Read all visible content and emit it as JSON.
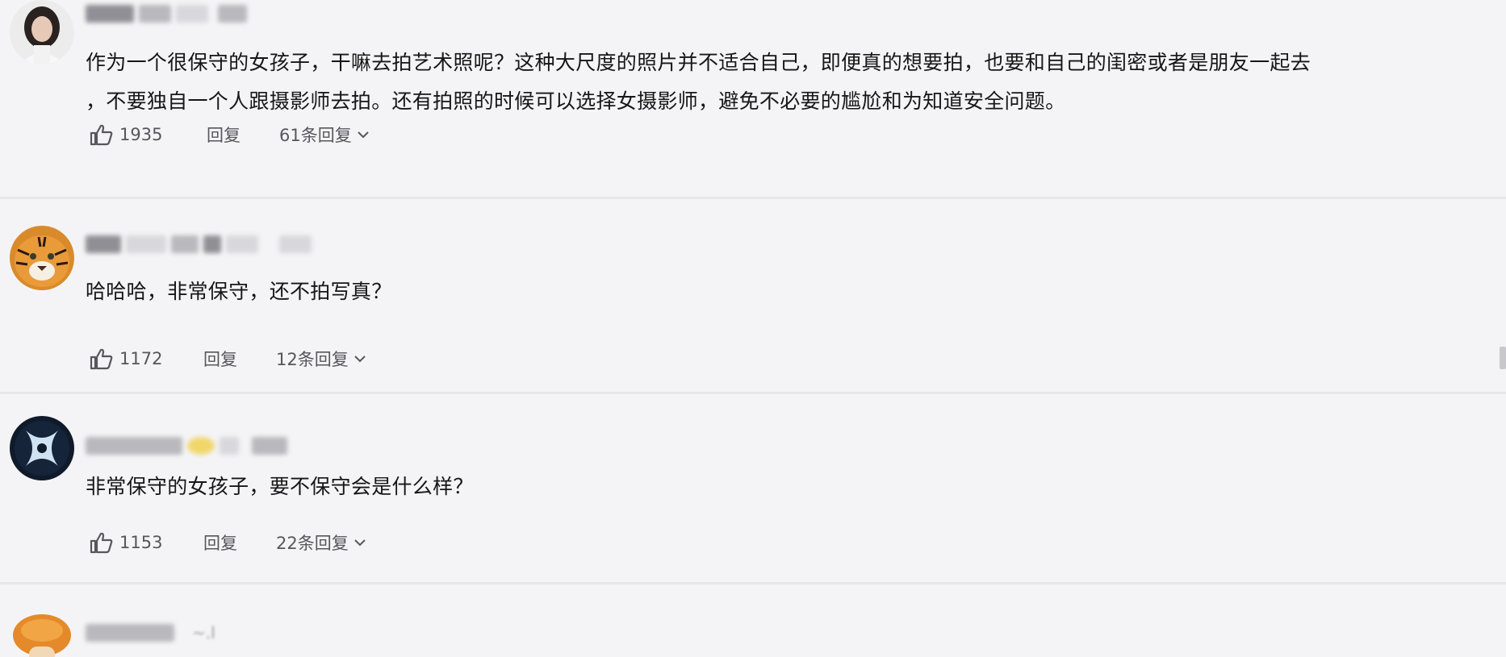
{
  "comments": [
    {
      "avatar_icon": "woman-portrait-icon",
      "text": "作为一个很保守的女孩子，干嘛去拍艺术照呢？这种大尺度的照片并不适合自己，即便真的想要拍，也要和自己的闺密或者是朋友一起去\n，不要独自一个人跟摄影师去拍。还有拍照的时候可以选择女摄影师，避免不必要的尴尬和为知道安全问题。",
      "likes": "1935",
      "reply_label": "回复",
      "replies_label": "61条回复"
    },
    {
      "avatar_icon": "tiger-icon",
      "text": "哈哈哈，非常保守，还不拍写真？",
      "likes": "1172",
      "reply_label": "回复",
      "replies_label": "12条回复"
    },
    {
      "avatar_icon": "x-logo-icon",
      "text": "非常保守的女孩子，要不保守会是什么样？",
      "likes": "1153",
      "reply_label": "回复",
      "replies_label": "22条回复"
    },
    {
      "avatar_icon": "mushroom-icon"
    }
  ],
  "colors": {
    "background": "#f4f4f6",
    "text": "#161616",
    "action_text": "#56565c"
  }
}
